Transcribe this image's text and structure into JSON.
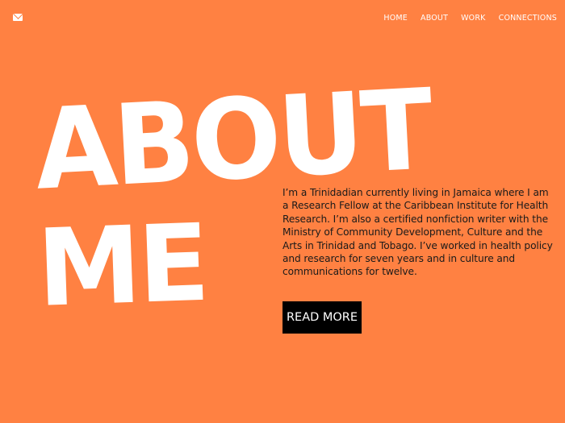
{
  "header": {
    "mail_icon": "envelope-icon",
    "nav": [
      {
        "label": "HOME"
      },
      {
        "label": "ABOUT"
      },
      {
        "label": "WORK"
      },
      {
        "label": "CONNECTIONS"
      }
    ]
  },
  "hero": {
    "line1": "ABOUT",
    "line2": "ME",
    "bio": "I’m a Trinidadian currently living in Jamaica where I am a Research Fellow at the Caribbean Institute for Health Research. I’m also a certified nonfiction writer with the Ministry of Community Development, Culture and the Arts in Trinidad and Tobago. I’ve worked in health policy and research for seven years and in culture and communications for twelve.",
    "button_label": "READ MORE"
  },
  "colors": {
    "background": "#ff8142",
    "heading": "#ffffff",
    "body_text": "#1a1a1a",
    "button_bg": "#000000"
  }
}
